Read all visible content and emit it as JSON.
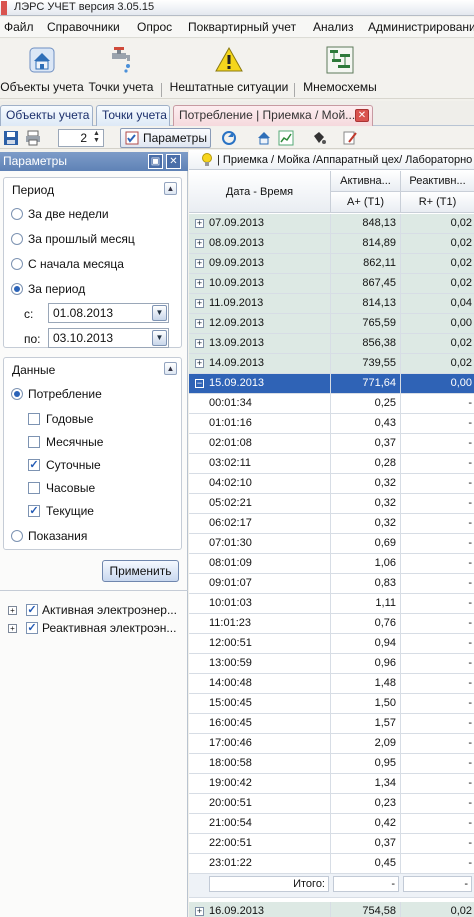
{
  "window": {
    "title": "ЛЭРС УЧЕТ версия 3.05.15"
  },
  "menu": [
    "Файл",
    "Справочники",
    "Опрос",
    "Поквартирный учет",
    "Анализ",
    "Администрирование"
  ],
  "toolbar": {
    "objects": "Объекты учета",
    "points": "Точки учета",
    "emergency": "Нештатные ситуации",
    "mnemo": "Мнемосхемы"
  },
  "tabs": [
    {
      "label": "Объекты учета"
    },
    {
      "label": "Точки учета"
    },
    {
      "label": "Потребление | Приемка / Мой..."
    }
  ],
  "toolbar2": {
    "page": "2",
    "params_label": "Параметры"
  },
  "params_panel": {
    "title": "Параметры",
    "period": {
      "title": "Период",
      "options": [
        "За две недели",
        "За прошлый месяц",
        "С начала месяца",
        "За период"
      ],
      "selected": "За период",
      "from_label": "с:",
      "from_value": "01.08.2013",
      "to_label": "по:",
      "to_value": "03.10.2013"
    },
    "data": {
      "title": "Данные",
      "consumption": "Потребление",
      "checks": [
        {
          "label": "Годовые",
          "checked": false
        },
        {
          "label": "Месячные",
          "checked": false
        },
        {
          "label": "Суточные",
          "checked": true
        },
        {
          "label": "Часовые",
          "checked": false
        },
        {
          "label": "Текущие",
          "checked": true
        }
      ],
      "readings": "Показания"
    },
    "apply": "Применить",
    "tree": [
      "Активная электроэнер...",
      "Реактивная электроэн..."
    ]
  },
  "report": {
    "header": "| Приемка / Мойка /Аппаратный цех/ Лабораторно",
    "columns": {
      "date": "Дата - Время",
      "a_top": "Активна...",
      "a_sub": "A+ (T1)",
      "r_top": "Реактивн...",
      "r_sub": "R+ (T1)"
    },
    "days_before": [
      {
        "date": "07.09.2013",
        "a": "848,13",
        "r": "0,02"
      },
      {
        "date": "08.09.2013",
        "a": "814,89",
        "r": "0,02"
      },
      {
        "date": "09.09.2013",
        "a": "862,11",
        "r": "0,02"
      },
      {
        "date": "10.09.2013",
        "a": "867,45",
        "r": "0,02"
      },
      {
        "date": "11.09.2013",
        "a": "814,13",
        "r": "0,04"
      },
      {
        "date": "12.09.2013",
        "a": "765,59",
        "r": "0,00"
      },
      {
        "date": "13.09.2013",
        "a": "856,38",
        "r": "0,02"
      },
      {
        "date": "14.09.2013",
        "a": "739,55",
        "r": "0,02"
      }
    ],
    "selected_day": {
      "date": "15.09.2013",
      "a": "771,64",
      "r": "0,00"
    },
    "hours": [
      {
        "t": "00:01:34",
        "a": "0,25",
        "r": "-"
      },
      {
        "t": "01:01:16",
        "a": "0,43",
        "r": "-"
      },
      {
        "t": "02:01:08",
        "a": "0,37",
        "r": "-"
      },
      {
        "t": "03:02:11",
        "a": "0,28",
        "r": "-"
      },
      {
        "t": "04:02:10",
        "a": "0,32",
        "r": "-"
      },
      {
        "t": "05:02:21",
        "a": "0,32",
        "r": "-"
      },
      {
        "t": "06:02:17",
        "a": "0,32",
        "r": "-"
      },
      {
        "t": "07:01:30",
        "a": "0,69",
        "r": "-"
      },
      {
        "t": "08:01:09",
        "a": "1,06",
        "r": "-"
      },
      {
        "t": "09:01:07",
        "a": "0,83",
        "r": "-"
      },
      {
        "t": "10:01:03",
        "a": "1,11",
        "r": "-"
      },
      {
        "t": "11:01:23",
        "a": "0,76",
        "r": "-"
      },
      {
        "t": "12:00:51",
        "a": "0,94",
        "r": "-"
      },
      {
        "t": "13:00:59",
        "a": "0,96",
        "r": "-"
      },
      {
        "t": "14:00:48",
        "a": "1,48",
        "r": "-"
      },
      {
        "t": "15:00:45",
        "a": "1,50",
        "r": "-"
      },
      {
        "t": "16:00:45",
        "a": "1,57",
        "r": "-"
      },
      {
        "t": "17:00:46",
        "a": "2,09",
        "r": "-"
      },
      {
        "t": "18:00:58",
        "a": "0,95",
        "r": "-"
      },
      {
        "t": "19:00:42",
        "a": "1,34",
        "r": "-"
      },
      {
        "t": "20:00:51",
        "a": "0,23",
        "r": "-"
      },
      {
        "t": "21:00:54",
        "a": "0,42",
        "r": "-"
      },
      {
        "t": "22:00:51",
        "a": "0,37",
        "r": "-"
      },
      {
        "t": "23:01:22",
        "a": "0,45",
        "r": "-"
      }
    ],
    "total": {
      "label": "Итого:",
      "a": "-",
      "r": "-"
    },
    "days_after": [
      {
        "date": "16.09.2013",
        "a": "754,58",
        "r": "0,02"
      }
    ]
  }
}
